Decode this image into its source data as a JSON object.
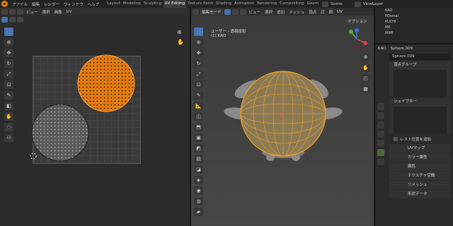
{
  "topbar": {
    "menus": [
      "ファイル",
      "編集",
      "レンダー",
      "ウィンドウ",
      "ヘルプ"
    ],
    "workspaces": [
      "Layout",
      "Modeling",
      "Sculpting",
      "UV Editing",
      "Texture Paint",
      "Shading",
      "Animation",
      "Rendering",
      "Compositing",
      "Geom"
    ],
    "active_workspace": "UV Editing",
    "scene": "Scene",
    "view_layer": "ViewLayer"
  },
  "uv_editor": {
    "menus": [
      "ビュー",
      "選択",
      "画像",
      "UV"
    ],
    "tools": [
      "select-icon",
      "cursor-icon",
      "move-icon",
      "rotate-icon",
      "scale-icon",
      "transform-icon",
      "annotate-icon",
      "rip-icon",
      "grab-icon",
      "relax-icon",
      "pinch-icon"
    ]
  },
  "viewport": {
    "mode": "編集モード",
    "menus": [
      "ビュー",
      "選択",
      "追加",
      "メッシュ",
      "頂点",
      "辺",
      "面",
      "UV"
    ],
    "view_name": "ユーザー・透視投影",
    "object_label": "(1) KAO",
    "options": "オプション"
  },
  "outliner": {
    "items": [
      "KAO",
      "KOsmal",
      "KUCHI",
      "ME",
      "MIMI"
    ]
  },
  "properties": {
    "object": "KAO",
    "mesh": "Sphere.009",
    "mesh_field": "Sphere.009",
    "vertex_groups": "頂点グループ",
    "shape_keys": "シェイプキー",
    "rest_position": "レスト位置を追加",
    "sections": [
      "UVマップ",
      "カラー属性",
      "属性",
      "テクスチャ空間",
      "リメッシュ",
      "形状データ"
    ]
  },
  "colors": {
    "accent": "#4772b3",
    "selection": "#e87d0d",
    "uv_face": "#555555"
  }
}
